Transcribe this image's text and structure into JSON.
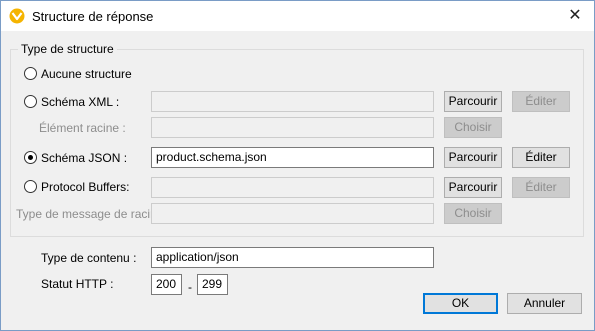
{
  "window": {
    "title": "Structure de réponse",
    "close_glyph": "✕"
  },
  "group": {
    "legend": "Type de structure"
  },
  "options": {
    "none_label": "Aucune structure",
    "xml_label": "Schéma XML :",
    "xml_root_label": "Élément racine :",
    "json_label": "Schéma JSON :",
    "json_value": "product.schema.json",
    "protobuf_label": "Protocol Buffers:",
    "protobuf_msg_label": "Type de message de racine"
  },
  "buttons": {
    "browse": "Parcourir",
    "edit": "Éditer",
    "choose": "Choisir",
    "ok": "OK",
    "cancel": "Annuler"
  },
  "content_type": {
    "label": "Type de contenu :",
    "value": "application/json"
  },
  "http_status": {
    "label": "Statut HTTP :",
    "from": "200",
    "to": "299",
    "separator": "-"
  },
  "selected_option": "json",
  "colors": {
    "accent": "#0078d7",
    "app_icon": "#f5b400"
  }
}
